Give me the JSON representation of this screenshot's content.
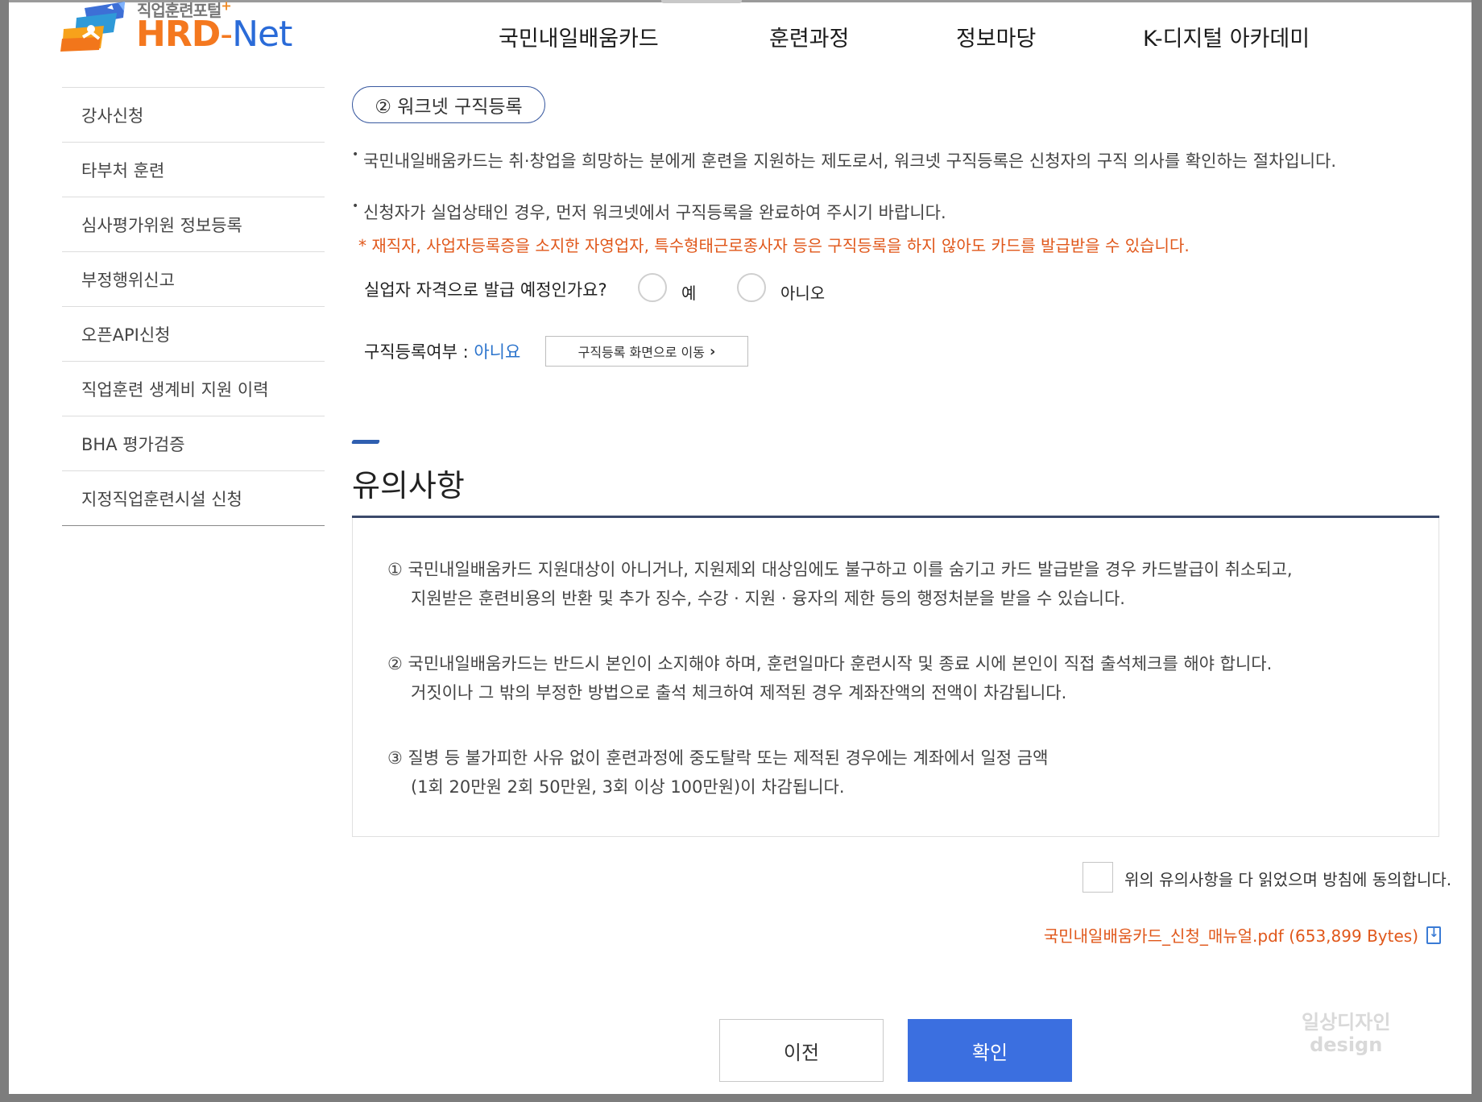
{
  "logo": {
    "sub": "직업훈련포털",
    "plus": "+",
    "brand_hrd": "HRD",
    "brand_dash": "-",
    "brand_net": "Net"
  },
  "nav": {
    "items": [
      "국민내일배움카드",
      "훈련과정",
      "정보마당",
      "K-디지털 아카데미"
    ]
  },
  "sidebar": {
    "items": [
      "강사신청",
      "타부처 훈련",
      "심사평가위원 정보등록",
      "부정행위신고",
      "오픈API신청",
      "직업훈련 생계비 지원 이력",
      "BHA 평가검증",
      "지정직업훈련시설 신청"
    ]
  },
  "step": {
    "label": "② 워크넷 구직등록"
  },
  "info": {
    "bullet1": "국민내일배움카드는 취·창업을 희망하는 분에게 훈련을 지원하는 제도로서, 워크넷 구직등록은 신청자의 구직 의사를 확인하는 절차입니다.",
    "bullet2": "신청자가 실업상태인 경우, 먼저 워크넷에서 구직등록을 완료하여 주시기 바랍니다.",
    "warning": "* 재직자, 사업자등록증을 소지한 자영업자, 특수형태근로종사자 등은 구직등록을 하지 않아도 카드를 발급받을 수 있습니다."
  },
  "question": {
    "label": "실업자 자격으로 발급 예정인가요?",
    "yes": "예",
    "no": "아니오"
  },
  "registration": {
    "label": "구직등록여부 : ",
    "value": "아니요",
    "button": "구직등록 화면으로 이동"
  },
  "notice": {
    "title": "유의사항",
    "items": [
      {
        "line1": "① 국민내일배움카드 지원대상이 아니거나, 지원제외 대상임에도 불구하고 이를 숨기고 카드 발급받을 경우 카드발급이 취소되고,",
        "line2": "지원받은 훈련비용의 반환 및 추가 징수, 수강 · 지원 · 융자의 제한 등의 행정처분을 받을 수 있습니다."
      },
      {
        "line1": "② 국민내일배움카드는 반드시 본인이 소지해야 하며, 훈련일마다 훈련시작 및 종료 시에 본인이 직접 출석체크를 해야 합니다.",
        "line2": "거짓이나 그 밖의 부정한 방법으로 출석 체크하여 제적된 경우 계좌잔액의 전액이 차감됩니다."
      },
      {
        "line1": "③ 질병 등 불가피한 사유 없이 훈련과정에 중도탈락 또는 제적된 경우에는 계좌에서 일정 금액",
        "line2": "(1회 20만원 2회 50만원, 3회 이상 100만원)이 차감됩니다."
      }
    ]
  },
  "agree": {
    "label": "위의 유의사항을 다 읽었으며 방침에 동의합니다."
  },
  "file": {
    "label": "국민내일배움카드_신청_매뉴얼.pdf (653,899 Bytes)"
  },
  "buttons": {
    "prev": "이전",
    "ok": "확인"
  },
  "watermark": {
    "line1": "일상디자인",
    "line2": "design"
  },
  "colors": {
    "accent_blue": "#3b6fe0",
    "warning_orange": "#e0571a",
    "link_blue": "#2a73cc"
  }
}
